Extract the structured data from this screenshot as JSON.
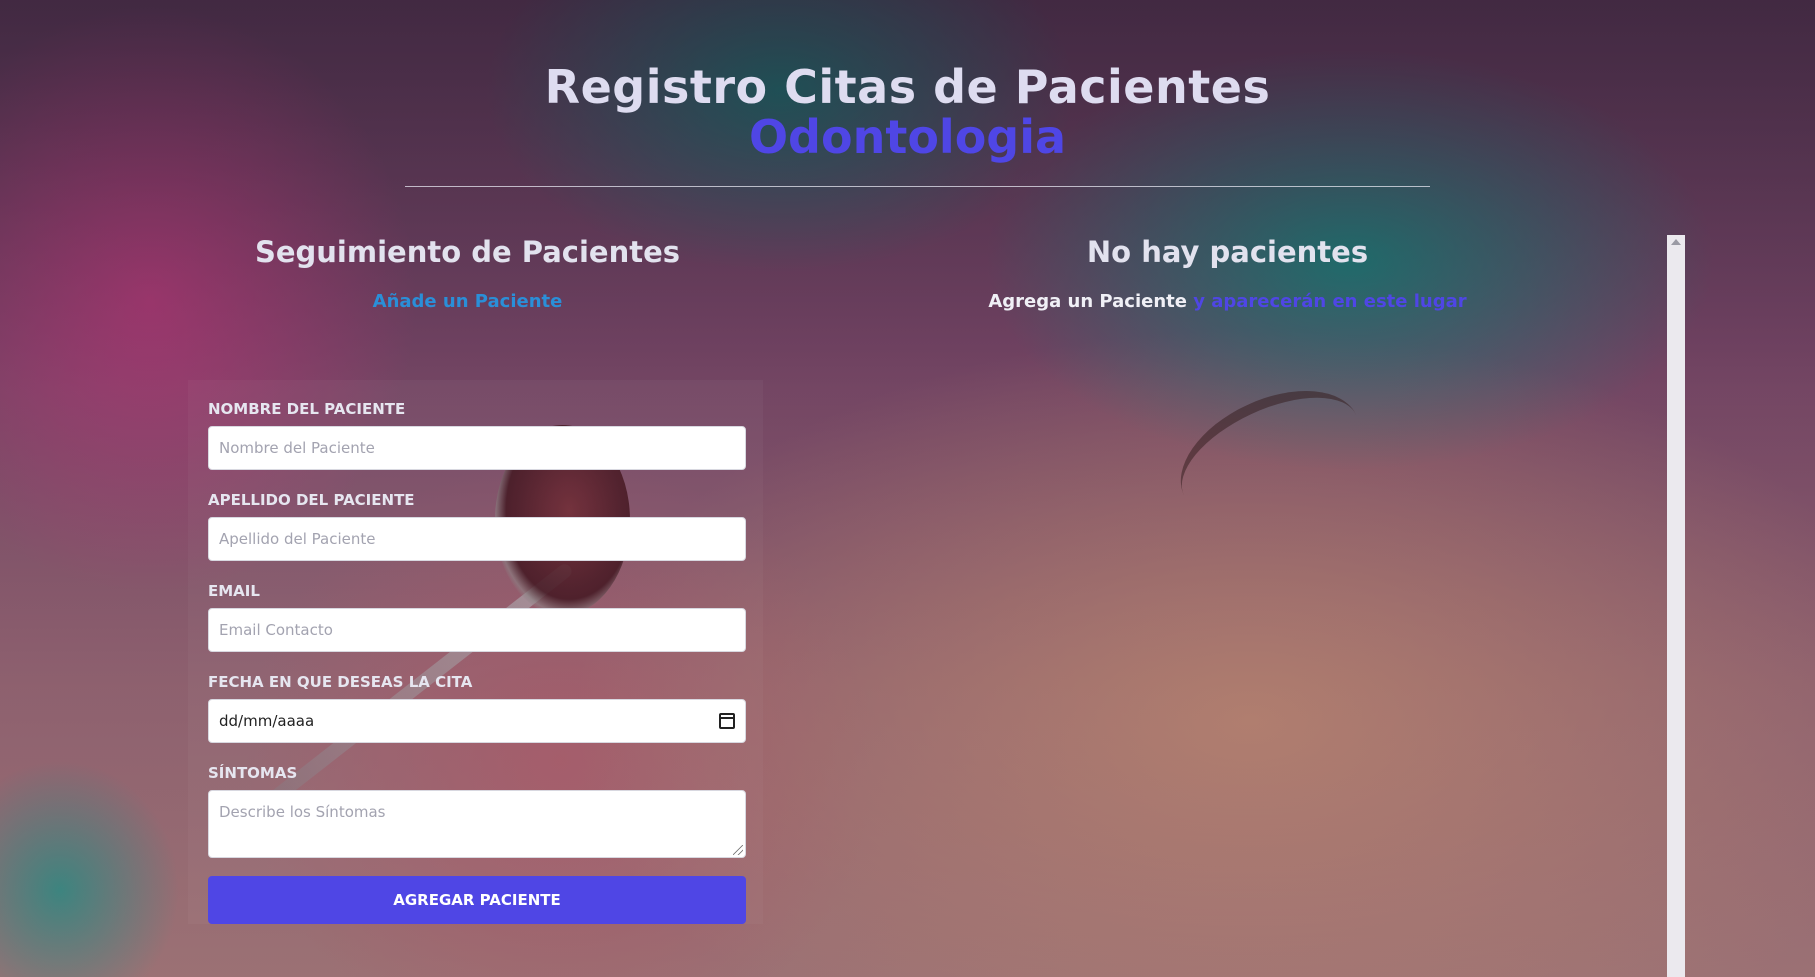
{
  "header": {
    "title": "Registro Citas de Pacientes",
    "subtitle": "Odontologia"
  },
  "left_panel": {
    "title": "Seguimiento de Pacientes",
    "subtitle": "Añade un Paciente"
  },
  "right_panel": {
    "title": "No hay pacientes",
    "subtitle_prefix": "Agrega un Paciente",
    "subtitle_suffix": " y aparecerán en este lugar"
  },
  "form": {
    "fields": [
      {
        "label": "NOMBRE DEL PACIENTE",
        "placeholder": "Nombre del Paciente"
      },
      {
        "label": "APELLIDO DEL PACIENTE",
        "placeholder": "Apellido del Paciente"
      },
      {
        "label": "EMAIL",
        "placeholder": "Email Contacto"
      },
      {
        "label": "FECHA EN QUE DESEAS LA CITA",
        "value": "dd/mm/aaaa"
      },
      {
        "label": "SÍNTOMAS",
        "placeholder": "Describe los Síntomas"
      }
    ],
    "submit_label": "AGREGAR PACIENTE"
  },
  "colors": {
    "accent_indigo": "#4f46e5",
    "accent_cyan": "#2a8fd8",
    "title_text": "#dedcf0"
  },
  "icons": [
    "calendar-icon",
    "resize-grip-icon",
    "scroll-up-arrow-icon"
  ]
}
